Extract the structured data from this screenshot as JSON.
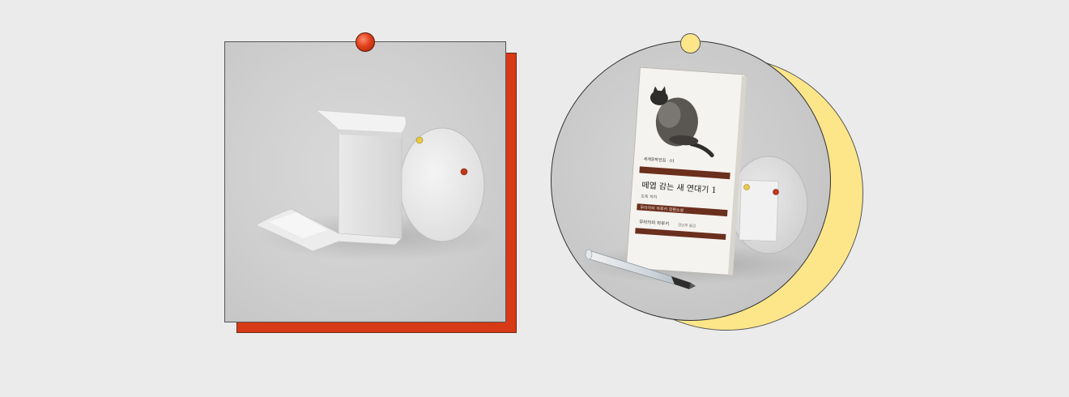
{
  "colors": {
    "background": "#ebebeb",
    "left_card_bg": "#cfcfcf",
    "left_shadow": "#d63a16",
    "left_pin": "#e0401c",
    "right_card_bg": "#c9c9c9",
    "right_moon": "#fde68a",
    "right_pin": "#fde68a",
    "book_band": "#6b2f1e"
  },
  "book": {
    "series_label": "세계문학전집 · 01",
    "title": "떼엽 감는 새 연대기 1",
    "subtitle": "도둑 까치",
    "band_text": "무라카미 하루키 장편소설",
    "author": "무라카미 하루키",
    "translator": "김난주 옮김"
  },
  "icons": {
    "left_pin": "push-pin-icon",
    "right_pin": "push-pin-icon",
    "magnet_yellow": "magnet-dot-icon",
    "magnet_red": "magnet-dot-icon"
  }
}
